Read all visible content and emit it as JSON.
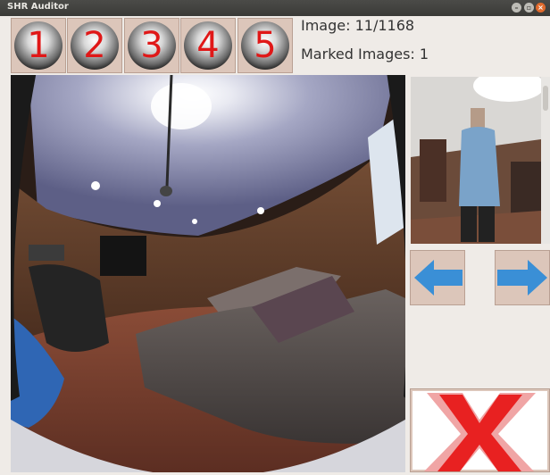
{
  "window": {
    "title": "SHR Auditor"
  },
  "rating_buttons": [
    {
      "label": "1"
    },
    {
      "label": "2"
    },
    {
      "label": "3"
    },
    {
      "label": "4"
    },
    {
      "label": "5"
    }
  ],
  "status": {
    "image_counter": "Image: 11/1168",
    "marked_images": "Marked Images: 1"
  },
  "colors": {
    "digit_red": "#e01818",
    "arrow_blue": "#3a8fd6",
    "x_red": "#e82121",
    "button_bg": "#dcc6ba"
  },
  "icons": {
    "prev": "left-arrow-icon",
    "next": "right-arrow-icon",
    "reject": "red-x-icon"
  }
}
